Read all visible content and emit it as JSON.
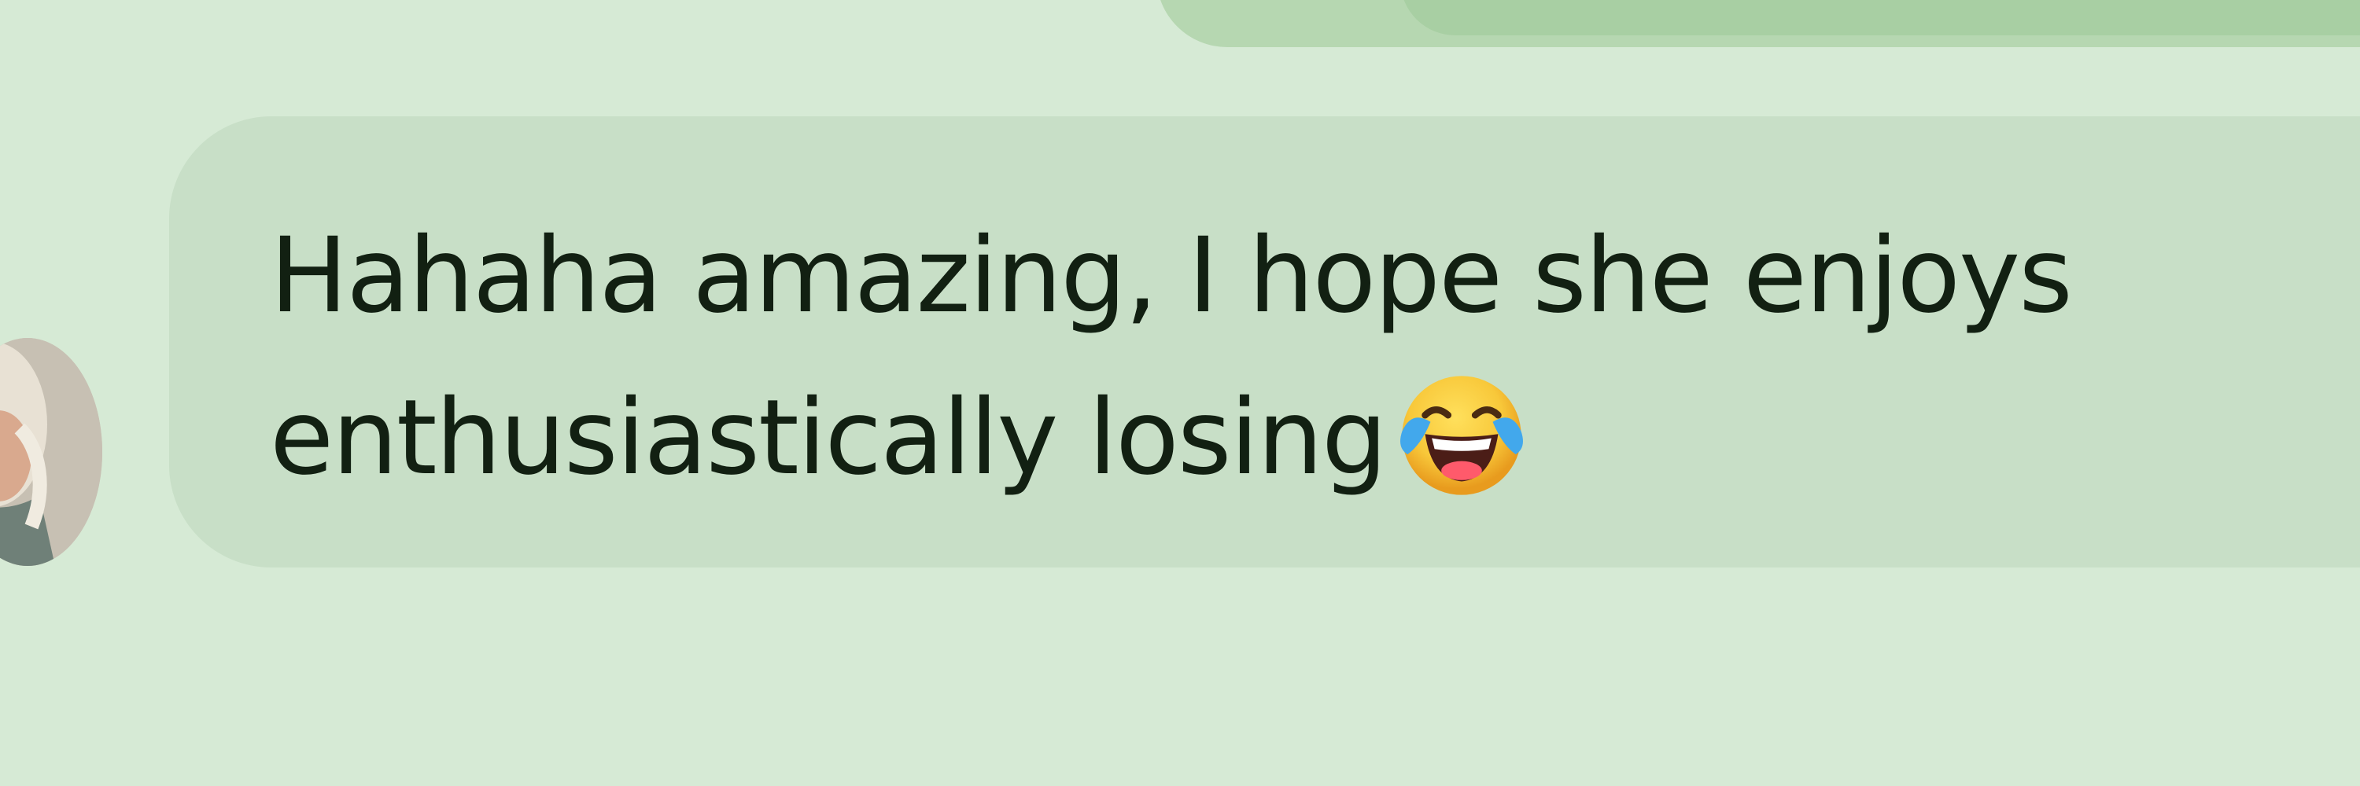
{
  "conversation": {
    "message": {
      "line1": "Hahaha amazing, I hope she enjoys",
      "line2": "enthusiastically losing",
      "emoji": "face-with-tears-of-joy-icon"
    }
  },
  "colors": {
    "background": "#d6ead5",
    "incoming_bubble": "#c8dfc7",
    "outgoing_bubble": "#b6d7b1",
    "text": "#122012"
  }
}
